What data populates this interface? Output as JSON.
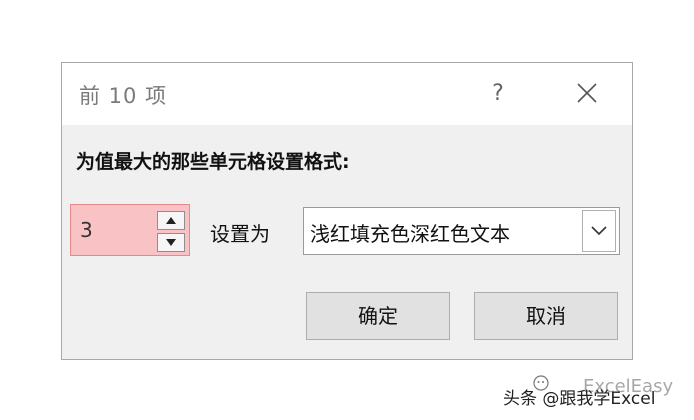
{
  "dialog": {
    "title": "前 10 项",
    "help_label": "?",
    "prompt": "为值最大的那些单元格设置格式:",
    "spinner_value": "3",
    "set_label": "设置为",
    "format_selected": "浅红填充色深红色文本",
    "ok_label": "确定",
    "cancel_label": "取消"
  },
  "colors": {
    "highlight_fill": "#f9c3c5",
    "highlight_border": "#e7898c",
    "dialog_bg": "#f0f0f0"
  },
  "icons": {
    "close": "close-icon",
    "spin_up": "triangle-up-icon",
    "spin_down": "triangle-down-icon",
    "dropdown": "chevron-down-icon",
    "watermark": "wechat-icon"
  },
  "watermark": {
    "text": "头条 @跟我学Excel",
    "overlay": "ExcelEasy"
  }
}
